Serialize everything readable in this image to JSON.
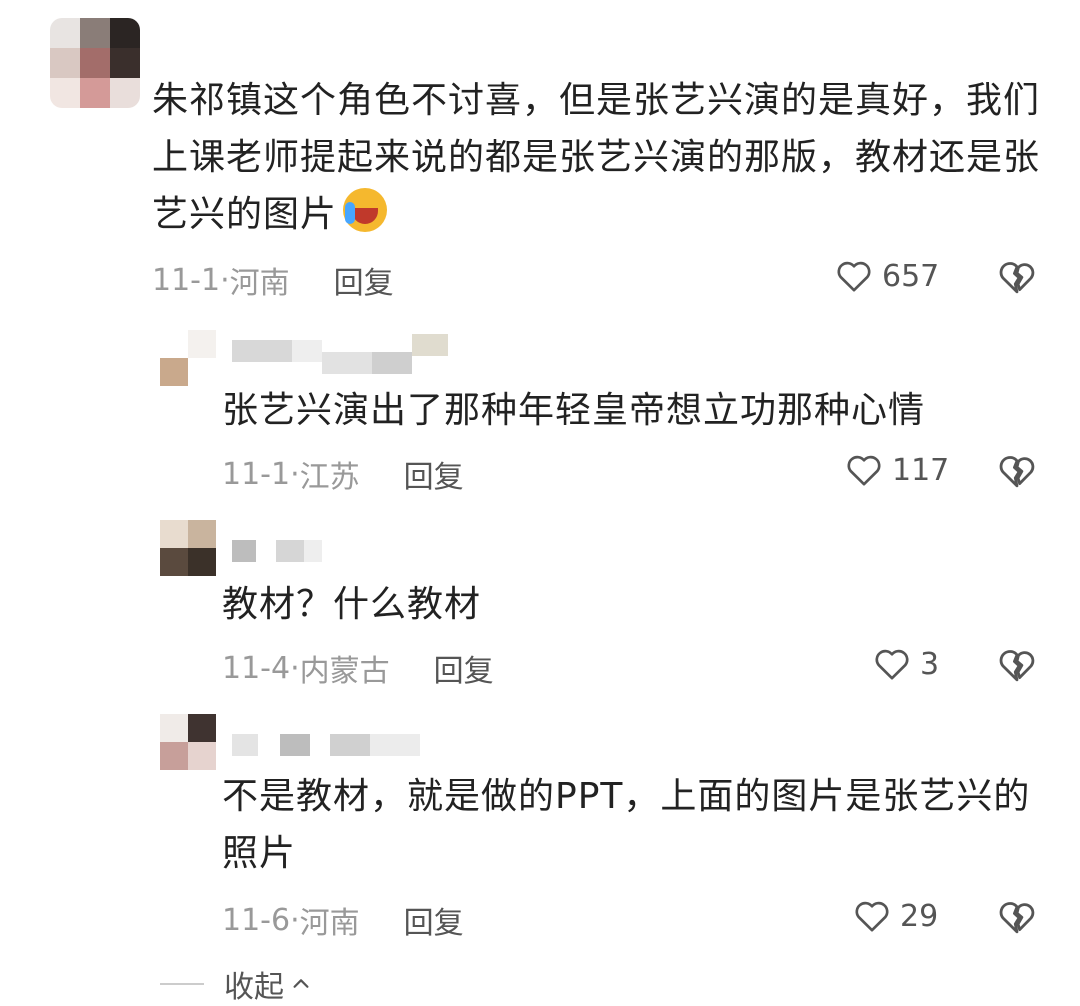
{
  "comments": [
    {
      "text_lines": [
        "朱祁镇这个角色不讨喜，但是张艺兴演的是真好，我们",
        "上课老师提起来说的都是张艺兴演的那版，教材还是张",
        "艺兴的图片"
      ],
      "date": "11-1·",
      "location": "河南",
      "reply_label": "回复",
      "likes": "657",
      "emoji_icon": "laugh-cry-emoji-icon"
    },
    {
      "text_lines": [
        "张艺兴演出了那种年轻皇帝想立功那种心情"
      ],
      "date": "11-1·",
      "location": "江苏",
      "reply_label": "回复",
      "likes": "117"
    },
    {
      "text_lines": [
        "教材？什么教材"
      ],
      "date": "11-4·",
      "location": "内蒙古",
      "reply_label": "回复",
      "likes": "3"
    },
    {
      "text_lines": [
        "不是教材，就是做的PPT，上面的图片是张艺兴的",
        "照片"
      ],
      "date": "11-6·",
      "location": "河南",
      "reply_label": "回复",
      "likes": "29"
    }
  ],
  "collapse_label": "收起",
  "icons": {
    "like": "heart-outline-icon",
    "dislike": "broken-heart-icon",
    "collapse": "chevron-up-icon"
  },
  "colors": {
    "text": "#222222",
    "meta": "#999999",
    "action": "#555555"
  }
}
